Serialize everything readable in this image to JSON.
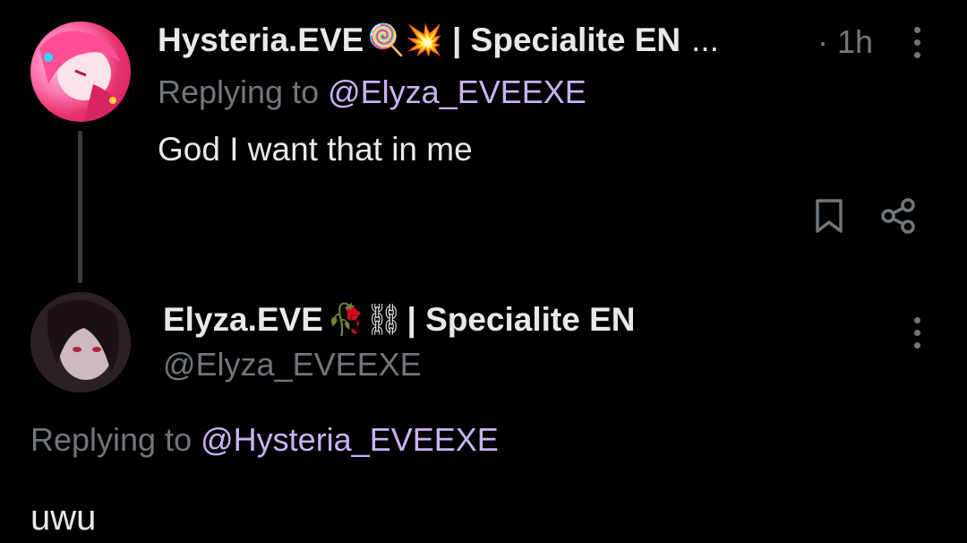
{
  "tweet1": {
    "display_name": "Hysteria.EVE",
    "name_emojis": "🍭💥",
    "name_suffix": "| Specialite EN",
    "name_truncation": "...",
    "time": "· 1h",
    "replying_prefix": "Replying to",
    "replying_handle": "@Elyza_EVEEXE",
    "text": "God I want that in me",
    "avatar_icon": "avatar-hysteria",
    "bookmark_icon": "bookmark-icon",
    "share_icon": "share-icon",
    "more_icon": "more-options-icon"
  },
  "tweet2": {
    "display_name": "Elyza.EVE",
    "name_emojis": "🥀⛓",
    "name_suffix": "| Specialite EN",
    "handle": "@Elyza_EVEEXE",
    "replying_prefix": "Replying to",
    "replying_handle": "@Hysteria_EVEEXE",
    "text": "uwu",
    "avatar_icon": "avatar-elyza",
    "more_icon": "more-options-icon"
  },
  "colors": {
    "background": "#000000",
    "primary_text": "#e7e9ea",
    "secondary_text": "#71767b",
    "mention": "#c9b3f5",
    "thread_line": "#3a3b3d"
  }
}
